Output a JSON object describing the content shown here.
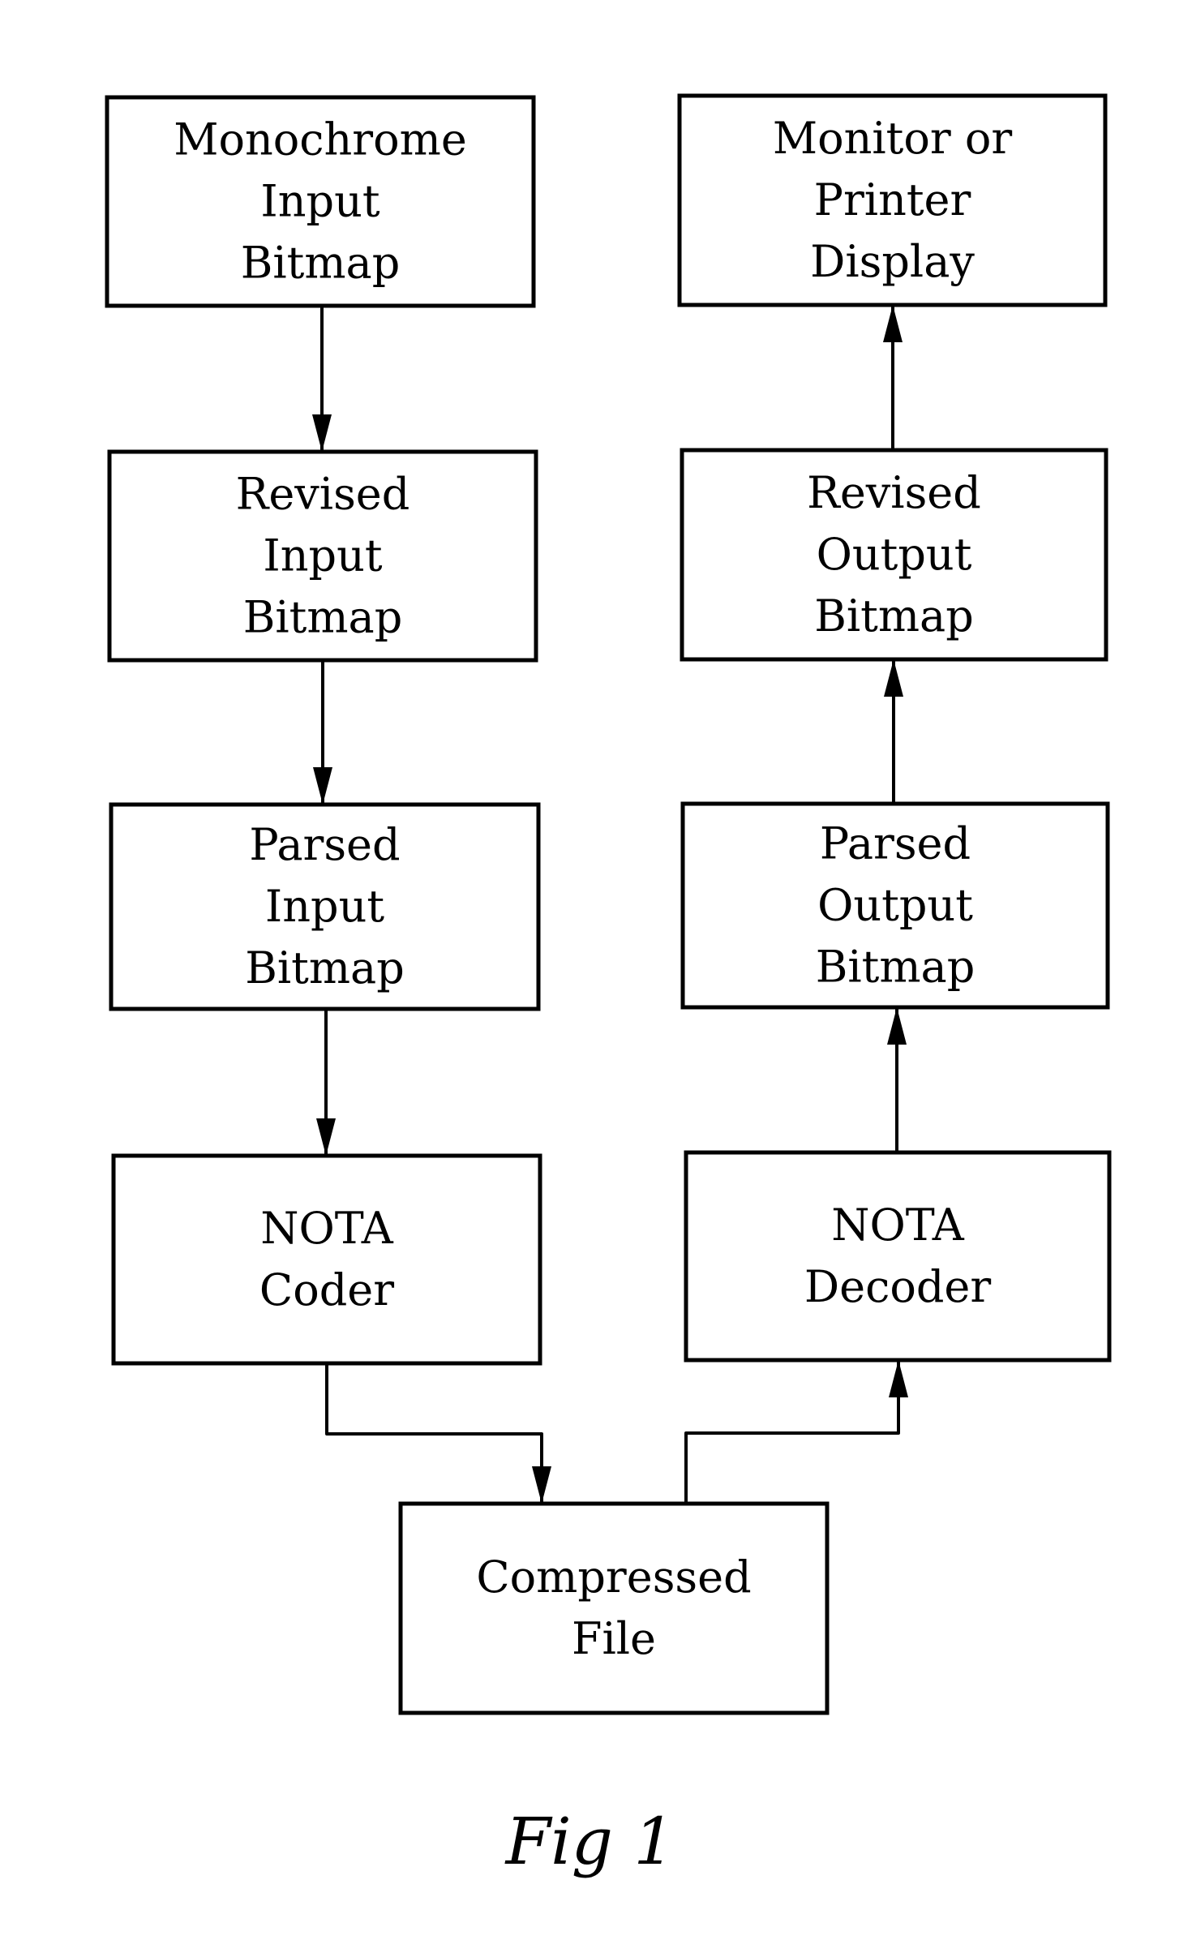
{
  "figure": {
    "caption": "Fig 1",
    "colors": {
      "line": "#000000",
      "background": "#ffffff"
    },
    "nodes": [
      {
        "id": "monochrome-input-bitmap",
        "lines": [
          "Monochrome",
          "Input",
          "Bitmap"
        ]
      },
      {
        "id": "revised-input-bitmap",
        "lines": [
          "Revised",
          "Input",
          "Bitmap"
        ]
      },
      {
        "id": "parsed-input-bitmap",
        "lines": [
          "Parsed",
          "Input",
          "Bitmap"
        ]
      },
      {
        "id": "nota-coder",
        "lines": [
          "NOTA",
          "Coder"
        ]
      },
      {
        "id": "compressed-file",
        "lines": [
          "Compressed",
          "File"
        ]
      },
      {
        "id": "nota-decoder",
        "lines": [
          "NOTA",
          "Decoder"
        ]
      },
      {
        "id": "parsed-output-bitmap",
        "lines": [
          "Parsed",
          "Output",
          "Bitmap"
        ]
      },
      {
        "id": "revised-output-bitmap",
        "lines": [
          "Revised",
          "Output",
          "Bitmap"
        ]
      },
      {
        "id": "monitor-or-printer-display",
        "lines": [
          "Monitor or",
          "Printer",
          "Display"
        ]
      }
    ],
    "edges": [
      {
        "from": "monochrome-input-bitmap",
        "to": "revised-input-bitmap"
      },
      {
        "from": "revised-input-bitmap",
        "to": "parsed-input-bitmap"
      },
      {
        "from": "parsed-input-bitmap",
        "to": "nota-coder"
      },
      {
        "from": "nota-coder",
        "to": "compressed-file"
      },
      {
        "from": "compressed-file",
        "to": "nota-decoder"
      },
      {
        "from": "nota-decoder",
        "to": "parsed-output-bitmap"
      },
      {
        "from": "parsed-output-bitmap",
        "to": "revised-output-bitmap"
      },
      {
        "from": "revised-output-bitmap",
        "to": "monitor-or-printer-display"
      }
    ]
  }
}
